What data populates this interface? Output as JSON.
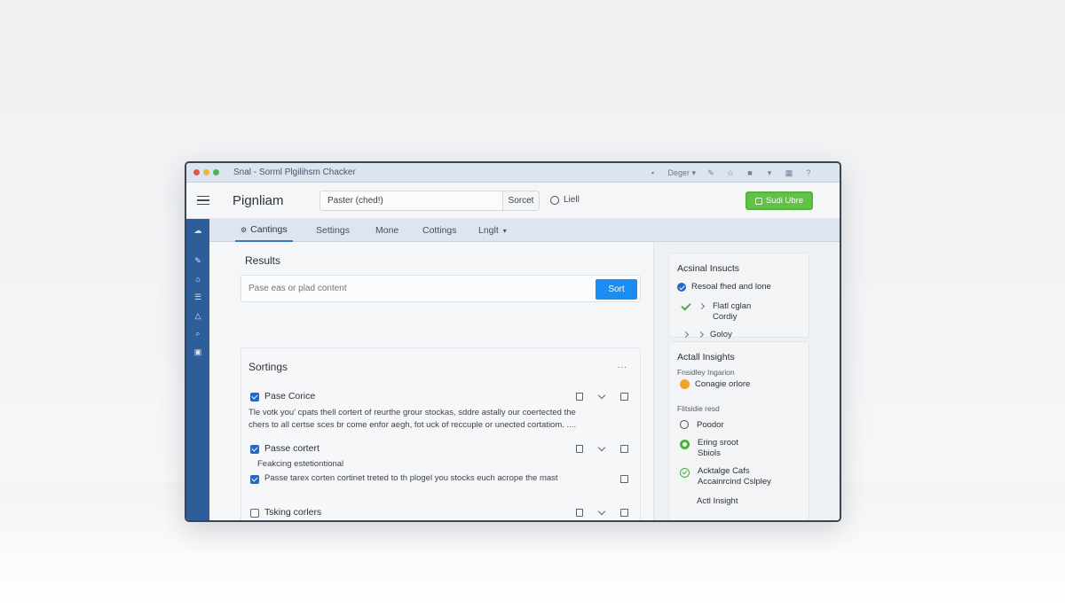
{
  "window": {
    "title": "Snal - Sorml Plgilihsm Chacker",
    "toolbar": {
      "dropdown": "Deger"
    }
  },
  "header": {
    "app_name": "Pignliam",
    "search_value": "Paster (ched!)",
    "search_button": "Sorcet",
    "help_label": "Liell",
    "cta_label": "Sudi Ubre"
  },
  "tabs": [
    "Cantings",
    "Settings",
    "Mone",
    "Cottings",
    "Lnglt"
  ],
  "main": {
    "results_heading": "Results",
    "paste_placeholder": "Pase eas or plad content",
    "sort_button": "Sort",
    "sortings": {
      "heading": "Sortings",
      "more": "...",
      "rows": [
        {
          "title": "Pase Corice",
          "checked": true
        },
        {
          "title": "Passe cortert",
          "checked": true
        },
        {
          "title": "Tsking corlers",
          "checked": false
        }
      ],
      "desc_line1": "Tle votk you' cpats thell cortert of reurthe grour stockas, sddre astally our coertected the",
      "desc_line2": "chers to all certse sces br come enfor aegh, fot uck of reccuple or unected cortatiom. ....",
      "sub_text": "Feakcing estetiontional",
      "sub_item": "Passe tarex corten cortinet treted to th plogel you stocks euch acrope the mast"
    }
  },
  "right": {
    "card1": {
      "heading": "Acsinal Insucts",
      "item1": "Resoal fhed and lone",
      "item2_line1": "Flatl cglan",
      "item2_line2": "Cordiy",
      "item3": "Goloy"
    },
    "card2": {
      "heading": "Actall Insights",
      "sub1": "Fnsidley Ingarion",
      "item1": "Conagie orlore",
      "sub2": "Flitsidie resd",
      "item2": "Poodor",
      "item3_line1": "Ering sroot",
      "item3_line2": "Sbiols",
      "item4_line1": "Acktalge Cafs",
      "item4_line2": "Accainrcind Cslpley",
      "item5": "Actl Insight"
    }
  },
  "colors": {
    "accent_blue": "#1a8ef0",
    "rail_blue": "#2d5e9a",
    "success_green": "#62c148",
    "warning_orange": "#efa52a"
  }
}
